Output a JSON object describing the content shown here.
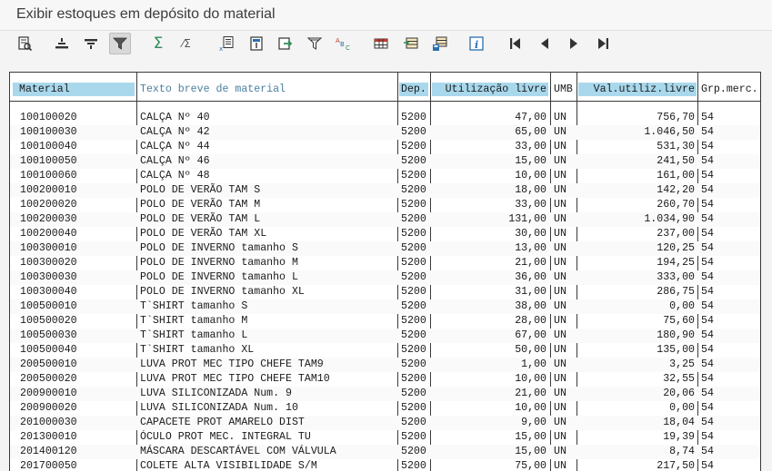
{
  "window": {
    "title": "Exibir estoques em depósito do material"
  },
  "toolbar": {
    "buttons": [
      {
        "name": "details-icon"
      },
      {
        "name": "sort-ascending-icon"
      },
      {
        "name": "sort-descending-icon"
      },
      {
        "name": "filter-icon"
      },
      {
        "name": "sum-icon",
        "label": "Σ"
      },
      {
        "name": "subtotal-icon",
        "label": "⁄Σ"
      },
      {
        "name": "export-spreadsheet-icon"
      },
      {
        "name": "print-preview-icon"
      },
      {
        "name": "export-icon"
      },
      {
        "name": "print-icon"
      },
      {
        "name": "abc-analysis-icon",
        "label": "ABC"
      },
      {
        "name": "change-layout-icon"
      },
      {
        "name": "select-layout-icon"
      },
      {
        "name": "save-layout-icon"
      },
      {
        "name": "information-icon",
        "label": "i"
      },
      {
        "name": "first-page-icon"
      },
      {
        "name": "previous-page-icon"
      },
      {
        "name": "next-page-icon"
      },
      {
        "name": "last-page-icon"
      }
    ]
  },
  "grid": {
    "columns": {
      "material": "Material",
      "description": "Texto breve de material",
      "plant": "Dep.",
      "free_use": "Utilização livre",
      "uom": "UMB",
      "value_free": "Val.utiliz.livre",
      "material_group": "Grp.merc."
    },
    "rows": [
      {
        "material": "100100020",
        "description": "CALÇA Nº 40",
        "plant": "5200",
        "free_use": "47,00",
        "uom": "UN",
        "value_free": "756,70",
        "material_group": "54"
      },
      {
        "material": "100100030",
        "description": "CALÇA Nº 42",
        "plant": "5200",
        "free_use": "65,00",
        "uom": "UN",
        "value_free": "1.046,50",
        "material_group": "54"
      },
      {
        "material": "100100040",
        "description": "CALÇA Nº 44",
        "plant": "5200",
        "free_use": "33,00",
        "uom": "UN",
        "value_free": "531,30",
        "material_group": "54"
      },
      {
        "material": "100100050",
        "description": "CALÇA Nº 46",
        "plant": "5200",
        "free_use": "15,00",
        "uom": "UN",
        "value_free": "241,50",
        "material_group": "54"
      },
      {
        "material": "100100060",
        "description": "CALÇA Nº 48",
        "plant": "5200",
        "free_use": "10,00",
        "uom": "UN",
        "value_free": "161,00",
        "material_group": "54"
      },
      {
        "material": "100200010",
        "description": "POLO DE VERÃO TAM S",
        "plant": "5200",
        "free_use": "18,00",
        "uom": "UN",
        "value_free": "142,20",
        "material_group": "54"
      },
      {
        "material": "100200020",
        "description": "POLO DE VERÃO TAM M",
        "plant": "5200",
        "free_use": "33,00",
        "uom": "UN",
        "value_free": "260,70",
        "material_group": "54"
      },
      {
        "material": "100200030",
        "description": "POLO DE VERÃO TAM L",
        "plant": "5200",
        "free_use": "131,00",
        "uom": "UN",
        "value_free": "1.034,90",
        "material_group": "54"
      },
      {
        "material": "100200040",
        "description": "POLO DE VERÃO TAM XL",
        "plant": "5200",
        "free_use": "30,00",
        "uom": "UN",
        "value_free": "237,00",
        "material_group": "54"
      },
      {
        "material": "100300010",
        "description": "POLO DE INVERNO tamanho S",
        "plant": "5200",
        "free_use": "13,00",
        "uom": "UN",
        "value_free": "120,25",
        "material_group": "54"
      },
      {
        "material": "100300020",
        "description": "POLO DE INVERNO tamanho M",
        "plant": "5200",
        "free_use": "21,00",
        "uom": "UN",
        "value_free": "194,25",
        "material_group": "54"
      },
      {
        "material": "100300030",
        "description": "POLO DE INVERNO tamanho L",
        "plant": "5200",
        "free_use": "36,00",
        "uom": "UN",
        "value_free": "333,00",
        "material_group": "54"
      },
      {
        "material": "100300040",
        "description": "POLO DE INVERNO tamanho XL",
        "plant": "5200",
        "free_use": "31,00",
        "uom": "UN",
        "value_free": "286,75",
        "material_group": "54"
      },
      {
        "material": "100500010",
        "description": "T`SHIRT tamanho S",
        "plant": "5200",
        "free_use": "38,00",
        "uom": "UN",
        "value_free": "0,00",
        "material_group": "54"
      },
      {
        "material": "100500020",
        "description": "T`SHIRT tamanho M",
        "plant": "5200",
        "free_use": "28,00",
        "uom": "UN",
        "value_free": "75,60",
        "material_group": "54"
      },
      {
        "material": "100500030",
        "description": "T`SHIRT tamanho L",
        "plant": "5200",
        "free_use": "67,00",
        "uom": "UN",
        "value_free": "180,90",
        "material_group": "54"
      },
      {
        "material": "100500040",
        "description": "T`SHIRT tamanho XL",
        "plant": "5200",
        "free_use": "50,00",
        "uom": "UN",
        "value_free": "135,00",
        "material_group": "54"
      },
      {
        "material": "200500010",
        "description": "LUVA PROT MEC TIPO CHEFE TAM9",
        "plant": "5200",
        "free_use": "1,00",
        "uom": "UN",
        "value_free": "3,25",
        "material_group": "54"
      },
      {
        "material": "200500020",
        "description": "LUVA PROT MEC TIPO CHEFE TAM10",
        "plant": "5200",
        "free_use": "10,00",
        "uom": "UN",
        "value_free": "32,55",
        "material_group": "54"
      },
      {
        "material": "200900010",
        "description": "LUVA SILICONIZADA Num. 9",
        "plant": "5200",
        "free_use": "21,00",
        "uom": "UN",
        "value_free": "20,06",
        "material_group": "54"
      },
      {
        "material": "200900020",
        "description": "LUVA SILICONIZADA Num. 10",
        "plant": "5200",
        "free_use": "10,00",
        "uom": "UN",
        "value_free": "0,00",
        "material_group": "54"
      },
      {
        "material": "201000030",
        "description": "CAPACETE PROT AMARELO DIST",
        "plant": "5200",
        "free_use": "9,00",
        "uom": "UN",
        "value_free": "18,04",
        "material_group": "54"
      },
      {
        "material": "201300010",
        "description": "ÓCULO PROT MEC. INTEGRAL TU",
        "plant": "5200",
        "free_use": "15,00",
        "uom": "UN",
        "value_free": "19,39",
        "material_group": "54"
      },
      {
        "material": "201400120",
        "description": "MÁSCARA DESCARTÁVEL COM VÁLVULA",
        "plant": "5200",
        "free_use": "15,00",
        "uom": "UN",
        "value_free": "8,74",
        "material_group": "54"
      },
      {
        "material": "201700050",
        "description": "COLETE ALTA VISIBILIDADE S/M",
        "plant": "5200",
        "free_use": "75,00",
        "uom": "UN",
        "value_free": "217,50",
        "material_group": "54"
      }
    ]
  },
  "colors": {
    "header_highlight": "#a9d8ec",
    "header_plain_text": "#4a7fa0",
    "icon_green": "#2e8b57",
    "icon_blue": "#2a6fb0"
  }
}
